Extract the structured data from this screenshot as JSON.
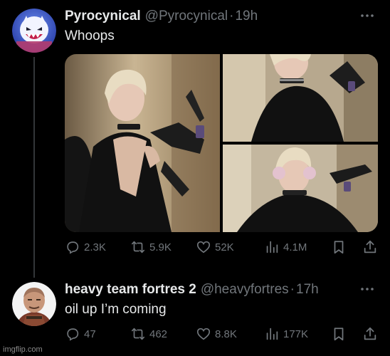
{
  "tweets": [
    {
      "name": "Pyrocynical",
      "handle": "@Pyrocynical",
      "separator": "·",
      "time": "19h",
      "text": "Whoops",
      "stats": {
        "replies": "2.3K",
        "retweets": "5.9K",
        "likes": "52K",
        "views": "4.1M"
      }
    },
    {
      "name": "heavy team fortres 2",
      "handle": "@heavyfortres",
      "separator": "·",
      "time": "17h",
      "text": "oil up I’m coming",
      "stats": {
        "replies": "47",
        "retweets": "462",
        "likes": "8.8K",
        "views": "177K"
      }
    }
  ],
  "watermark": "imgflip.com",
  "colors": {
    "background": "#000000",
    "primary_text": "#e7e9ea",
    "secondary_text": "#71767b",
    "thread_line": "#333639"
  },
  "icons": [
    "more-icon",
    "reply-icon",
    "retweet-icon",
    "like-icon",
    "views-icon",
    "bookmark-icon",
    "share-icon"
  ]
}
